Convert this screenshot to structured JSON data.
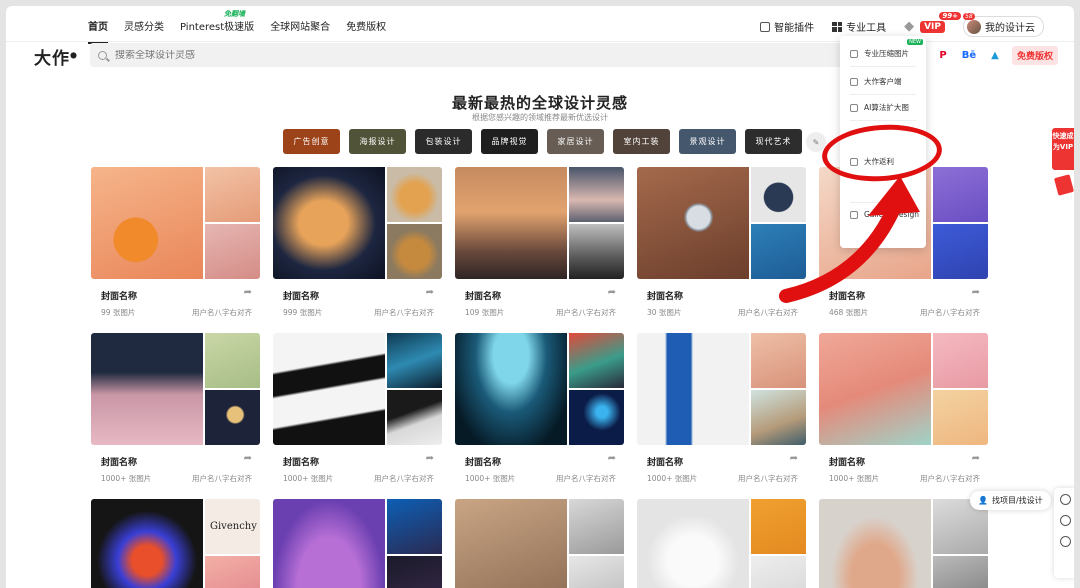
{
  "nav": {
    "items": [
      "首页",
      "灵感分类",
      "Pinterest极速版",
      "全球网站聚合",
      "免费版权"
    ],
    "free_tag": "免翻墙",
    "plugin": "智能插件",
    "pro_tools": "专业工具",
    "vip": "VIP",
    "vip_count": "99+",
    "my_design": "我的设计云",
    "my_design_count": "58"
  },
  "brand": {
    "logo": "大作"
  },
  "search": {
    "placeholder": "搜索全球设计灵感"
  },
  "social": {
    "pinterest": "P",
    "behance": "Bē",
    "artstation": "▲",
    "free_copyright": "免费版权"
  },
  "headline": {
    "title": "最新最热的全球设计灵感",
    "subtitle": "根据您感兴趣的领域推荐最新优选设计"
  },
  "categories": [
    {
      "label": "广告创意",
      "color": "#d25a22"
    },
    {
      "label": "海报设计",
      "color": "#6b6f4a"
    },
    {
      "label": "包装设计",
      "color": "#3a3a3a"
    },
    {
      "label": "品牌视觉",
      "color": "#2a2a2a"
    },
    {
      "label": "家居设计",
      "color": "#8a7d72"
    },
    {
      "label": "室内工装",
      "color": "#6d5a4c"
    },
    {
      "label": "景观设计",
      "color": "#5c7590"
    },
    {
      "label": "现代艺术",
      "color": "#3d3d3d"
    }
  ],
  "cards": [
    {
      "title": "封面名称",
      "count": "99 张图片",
      "user": "用户名八字右对齐"
    },
    {
      "title": "封面名称",
      "count": "999 张图片",
      "user": "用户名八字右对齐"
    },
    {
      "title": "封面名称",
      "count": "109 张图片",
      "user": "用户名八字右对齐"
    },
    {
      "title": "封面名称",
      "count": "30 张图片",
      "user": "用户名八字右对齐"
    },
    {
      "title": "封面名称",
      "count": "468 张图片",
      "user": "用户名八字右对齐"
    },
    {
      "title": "封面名称",
      "count": "1000+ 张图片",
      "user": "用户名八字右对齐"
    },
    {
      "title": "封面名称",
      "count": "1000+ 张图片",
      "user": "用户名八字右对齐"
    },
    {
      "title": "封面名称",
      "count": "1000+ 张图片",
      "user": "用户名八字右对齐"
    },
    {
      "title": "封面名称",
      "count": "1000+ 张图片",
      "user": "用户名八字右对齐"
    },
    {
      "title": "封面名称",
      "count": "1000+ 张图片",
      "user": "用户名八字右对齐"
    }
  ],
  "bottom_card_text": "Givenchy",
  "dropdown": {
    "items": [
      "专业压缩图片",
      "大作客户端",
      "AI算法扩大图",
      "",
      "大作返利",
      "",
      "Gallery Design"
    ],
    "new_tag": "NEW"
  },
  "float": {
    "quick_vip": "快速成为VIP",
    "find": "找项目/找设计"
  }
}
